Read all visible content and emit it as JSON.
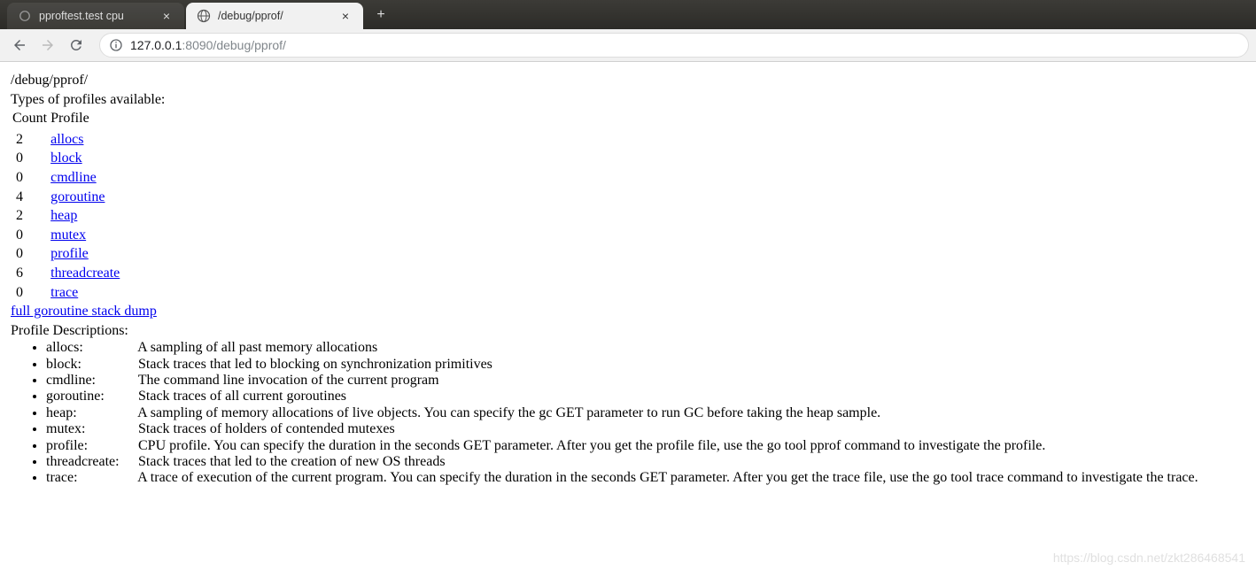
{
  "tabs": [
    {
      "title": "pproftest.test cpu",
      "active": false
    },
    {
      "title": "/debug/pprof/",
      "active": true
    }
  ],
  "url": {
    "host": "127.0.0.1",
    "port_path": ":8090/debug/pprof/"
  },
  "page": {
    "title": "/debug/pprof/",
    "types_available": "Types of profiles available:",
    "table_headers": {
      "count": "Count",
      "profile": "Profile"
    },
    "profiles": [
      {
        "count": "2",
        "name": "allocs"
      },
      {
        "count": "0",
        "name": "block"
      },
      {
        "count": "0",
        "name": "cmdline"
      },
      {
        "count": "4",
        "name": "goroutine"
      },
      {
        "count": "2",
        "name": "heap"
      },
      {
        "count": "0",
        "name": "mutex"
      },
      {
        "count": "0",
        "name": "profile"
      },
      {
        "count": "6",
        "name": "threadcreate"
      },
      {
        "count": "0",
        "name": "trace"
      }
    ],
    "full_dump": "full goroutine stack dump",
    "descriptions_heading": "Profile Descriptions:",
    "descriptions": [
      {
        "name": "allocs:",
        "text": "A sampling of all past memory allocations"
      },
      {
        "name": "block:",
        "text": "Stack traces that led to blocking on synchronization primitives"
      },
      {
        "name": "cmdline:",
        "text": "The command line invocation of the current program"
      },
      {
        "name": "goroutine:",
        "text": "Stack traces of all current goroutines"
      },
      {
        "name": "heap:",
        "text": "A sampling of memory allocations of live objects. You can specify the gc GET parameter to run GC before taking the heap sample."
      },
      {
        "name": "mutex:",
        "text": "Stack traces of holders of contended mutexes"
      },
      {
        "name": "profile:",
        "text": "CPU profile. You can specify the duration in the seconds GET parameter. After you get the profile file, use the go tool pprof command to investigate the profile."
      },
      {
        "name": "threadcreate:",
        "text": "Stack traces that led to the creation of new OS threads"
      },
      {
        "name": "trace:",
        "text": "A trace of execution of the current program. You can specify the duration in the seconds GET parameter. After you get the trace file, use the go tool trace command to investigate the trace."
      }
    ]
  },
  "watermark": "https://blog.csdn.net/zkt286468541"
}
